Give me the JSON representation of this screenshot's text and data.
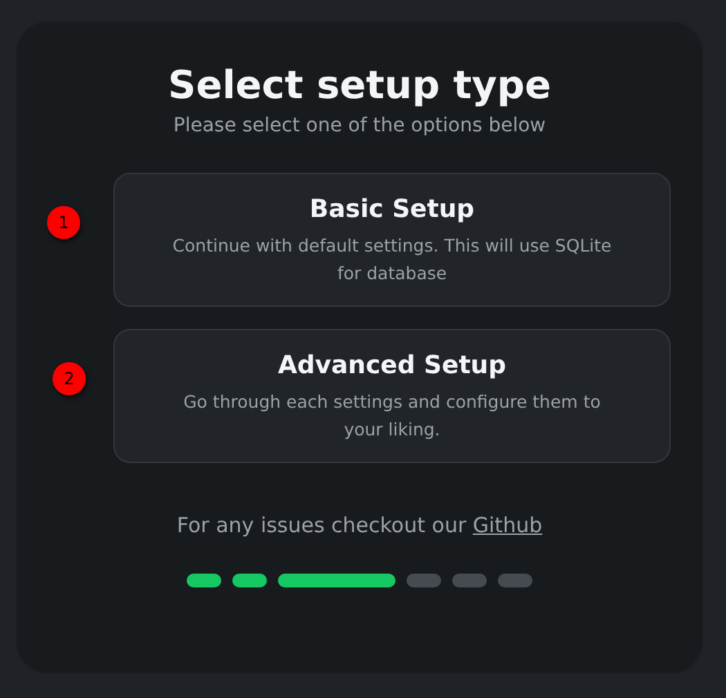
{
  "title": "Select setup type",
  "subtitle": "Please select one of the options below",
  "options": [
    {
      "marker": "1",
      "title": "Basic Setup",
      "description": "Continue with default settings. This will use SQLite for database"
    },
    {
      "marker": "2",
      "title": "Advanced Setup",
      "description": "Go through each settings and configure them to your liking."
    }
  ],
  "footer": {
    "text": "For any issues checkout our",
    "link": "Github"
  },
  "steps": [
    {
      "kind": "done"
    },
    {
      "kind": "done"
    },
    {
      "kind": "current"
    },
    {
      "kind": "todo"
    },
    {
      "kind": "todo"
    },
    {
      "kind": "todo"
    }
  ]
}
